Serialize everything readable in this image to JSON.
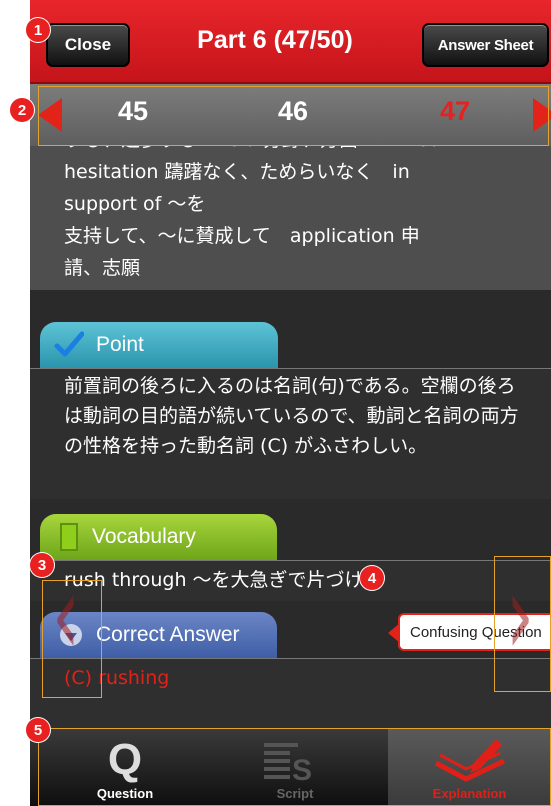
{
  "header": {
    "close_label": "Close",
    "title": "Part 6 (47/50)",
    "answer_sheet_label": "Answer Sheet"
  },
  "question_nav": {
    "numbers": [
      "45",
      "46",
      "47"
    ],
    "current": "47"
  },
  "content": {
    "vocab_top_lines": [
      "する、進歩する　field 分野、方面　without",
      "hesitation 躊躇なく、ためらいなく　in",
      "support of ～を",
      "支持して、～に賛成して　application 申",
      "請、志願"
    ],
    "point": {
      "label": "Point",
      "text": "前置詞の後ろに入るのは名詞(句)である。空欄の後ろは動詞の目的語が続いているので、動詞と名詞の両方の性格を持った動名詞 (C) がふさわしい。"
    },
    "vocabulary": {
      "label": "Vocabulary",
      "text": "rush through ～を大急ぎで片づける"
    },
    "correct_answer": {
      "label": "Correct Answer",
      "text": "(C) rushing"
    },
    "confusing_button_label": "Confusing Question"
  },
  "tabbar": {
    "question_label": "Question",
    "script_label": "Script",
    "explanation_label": "Explanation"
  },
  "callouts": [
    "1",
    "2",
    "3",
    "4",
    "5"
  ],
  "colors": {
    "header_red": "#d41c21",
    "current_question": "#e8201f",
    "point_tab": "#3aa9c0",
    "vocabulary_tab": "#86bd26",
    "correct_answer_tab": "#5270b6",
    "answer_text": "#e0221a"
  }
}
